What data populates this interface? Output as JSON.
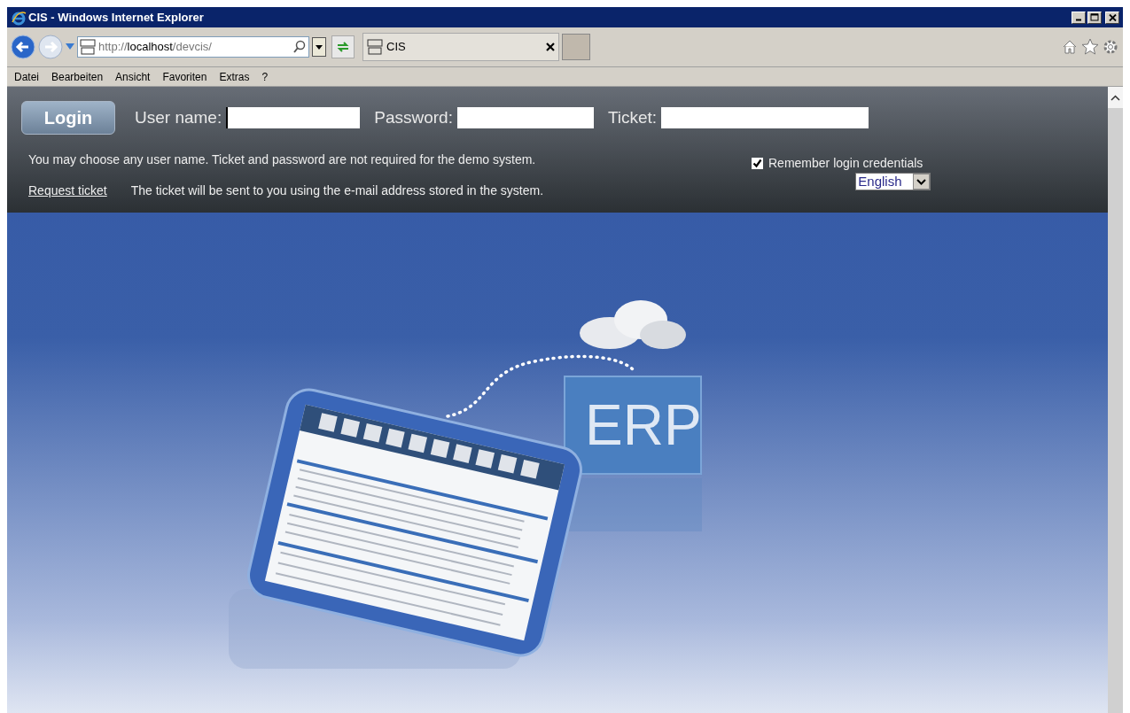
{
  "window": {
    "title": "CIS - Windows Internet Explorer"
  },
  "address_bar": {
    "url_prefix": "http://",
    "url_host": "localhost",
    "url_path": "/devcis/"
  },
  "tabs": [
    {
      "label": "CIS",
      "selected": true
    }
  ],
  "menu": [
    "Datei",
    "Bearbeiten",
    "Ansicht",
    "Favoriten",
    "Extras",
    "?"
  ],
  "login": {
    "button": "Login",
    "fields": [
      {
        "label": "User name:",
        "focused": true
      },
      {
        "label": "Password:",
        "focused": false
      },
      {
        "label": "Ticket:",
        "focused": false
      }
    ],
    "hint": "You may choose any user name. Ticket and password are not required for the demo system.",
    "request_link": "Request ticket",
    "request_note": "The ticket will be sent to you using the e-mail address stored in the system.",
    "remember": {
      "label": "Remember login credentials",
      "checked": true
    },
    "language": "English"
  },
  "illustration": {
    "erp_label": "ERP"
  }
}
